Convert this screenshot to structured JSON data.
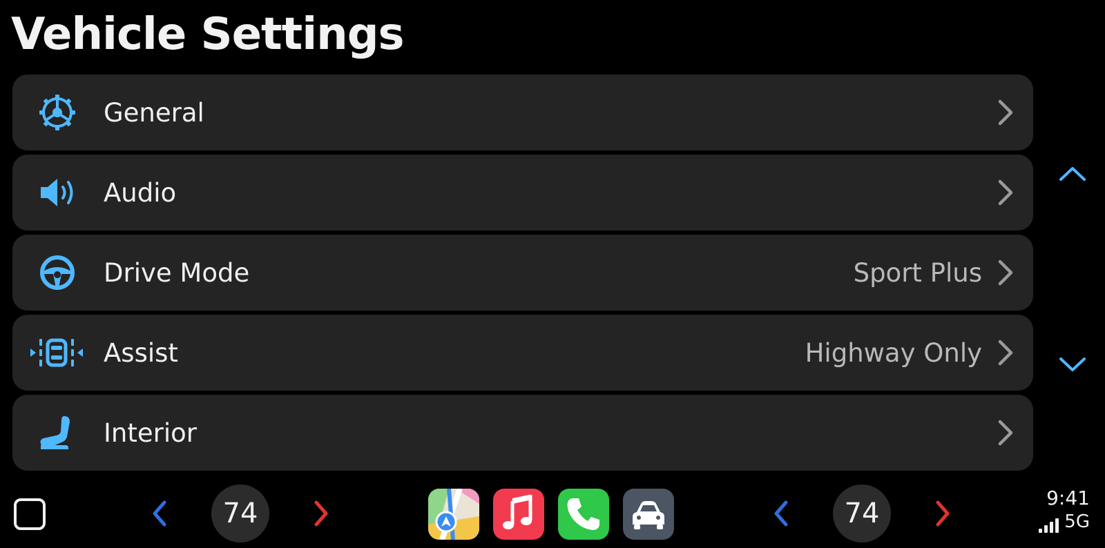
{
  "page": {
    "title": "Vehicle Settings"
  },
  "colors": {
    "accent": "#4fb8ff",
    "row_bg": "#242424",
    "background": "#000000",
    "value_text": "#b9b9b9"
  },
  "settings": [
    {
      "label": "General",
      "value": "",
      "icon": "gear-icon"
    },
    {
      "label": "Audio",
      "value": "",
      "icon": "speaker-icon"
    },
    {
      "label": "Drive Mode",
      "value": "Sport Plus",
      "icon": "steering-wheel-icon"
    },
    {
      "label": "Assist",
      "value": "Highway Only",
      "icon": "lane-assist-icon"
    },
    {
      "label": "Interior",
      "value": "",
      "icon": "seat-icon"
    }
  ],
  "dock": {
    "left_temp": "74",
    "right_temp": "74",
    "apps": [
      "maps",
      "music",
      "phone",
      "car"
    ],
    "time": "9:41",
    "network": "5G"
  }
}
